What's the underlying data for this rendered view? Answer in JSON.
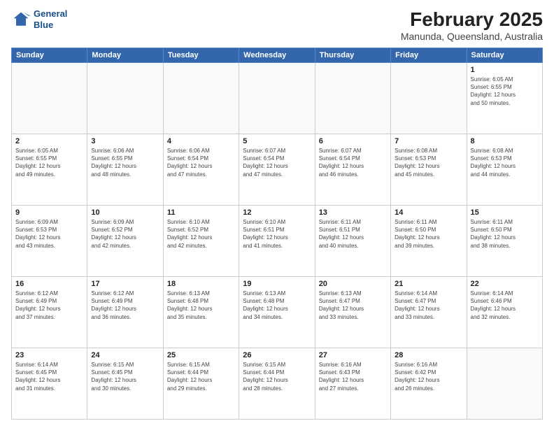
{
  "logo": {
    "line1": "General",
    "line2": "Blue"
  },
  "title": "February 2025",
  "subtitle": "Manunda, Queensland, Australia",
  "header_days": [
    "Sunday",
    "Monday",
    "Tuesday",
    "Wednesday",
    "Thursday",
    "Friday",
    "Saturday"
  ],
  "weeks": [
    [
      {
        "day": "",
        "info": ""
      },
      {
        "day": "",
        "info": ""
      },
      {
        "day": "",
        "info": ""
      },
      {
        "day": "",
        "info": ""
      },
      {
        "day": "",
        "info": ""
      },
      {
        "day": "",
        "info": ""
      },
      {
        "day": "1",
        "info": "Sunrise: 6:05 AM\nSunset: 6:55 PM\nDaylight: 12 hours\nand 50 minutes."
      }
    ],
    [
      {
        "day": "2",
        "info": "Sunrise: 6:05 AM\nSunset: 6:55 PM\nDaylight: 12 hours\nand 49 minutes."
      },
      {
        "day": "3",
        "info": "Sunrise: 6:06 AM\nSunset: 6:55 PM\nDaylight: 12 hours\nand 48 minutes."
      },
      {
        "day": "4",
        "info": "Sunrise: 6:06 AM\nSunset: 6:54 PM\nDaylight: 12 hours\nand 47 minutes."
      },
      {
        "day": "5",
        "info": "Sunrise: 6:07 AM\nSunset: 6:54 PM\nDaylight: 12 hours\nand 47 minutes."
      },
      {
        "day": "6",
        "info": "Sunrise: 6:07 AM\nSunset: 6:54 PM\nDaylight: 12 hours\nand 46 minutes."
      },
      {
        "day": "7",
        "info": "Sunrise: 6:08 AM\nSunset: 6:53 PM\nDaylight: 12 hours\nand 45 minutes."
      },
      {
        "day": "8",
        "info": "Sunrise: 6:08 AM\nSunset: 6:53 PM\nDaylight: 12 hours\nand 44 minutes."
      }
    ],
    [
      {
        "day": "9",
        "info": "Sunrise: 6:09 AM\nSunset: 6:53 PM\nDaylight: 12 hours\nand 43 minutes."
      },
      {
        "day": "10",
        "info": "Sunrise: 6:09 AM\nSunset: 6:52 PM\nDaylight: 12 hours\nand 42 minutes."
      },
      {
        "day": "11",
        "info": "Sunrise: 6:10 AM\nSunset: 6:52 PM\nDaylight: 12 hours\nand 42 minutes."
      },
      {
        "day": "12",
        "info": "Sunrise: 6:10 AM\nSunset: 6:51 PM\nDaylight: 12 hours\nand 41 minutes."
      },
      {
        "day": "13",
        "info": "Sunrise: 6:11 AM\nSunset: 6:51 PM\nDaylight: 12 hours\nand 40 minutes."
      },
      {
        "day": "14",
        "info": "Sunrise: 6:11 AM\nSunset: 6:50 PM\nDaylight: 12 hours\nand 39 minutes."
      },
      {
        "day": "15",
        "info": "Sunrise: 6:11 AM\nSunset: 6:50 PM\nDaylight: 12 hours\nand 38 minutes."
      }
    ],
    [
      {
        "day": "16",
        "info": "Sunrise: 6:12 AM\nSunset: 6:49 PM\nDaylight: 12 hours\nand 37 minutes."
      },
      {
        "day": "17",
        "info": "Sunrise: 6:12 AM\nSunset: 6:49 PM\nDaylight: 12 hours\nand 36 minutes."
      },
      {
        "day": "18",
        "info": "Sunrise: 6:13 AM\nSunset: 6:48 PM\nDaylight: 12 hours\nand 35 minutes."
      },
      {
        "day": "19",
        "info": "Sunrise: 6:13 AM\nSunset: 6:48 PM\nDaylight: 12 hours\nand 34 minutes."
      },
      {
        "day": "20",
        "info": "Sunrise: 6:13 AM\nSunset: 6:47 PM\nDaylight: 12 hours\nand 33 minutes."
      },
      {
        "day": "21",
        "info": "Sunrise: 6:14 AM\nSunset: 6:47 PM\nDaylight: 12 hours\nand 33 minutes."
      },
      {
        "day": "22",
        "info": "Sunrise: 6:14 AM\nSunset: 6:46 PM\nDaylight: 12 hours\nand 32 minutes."
      }
    ],
    [
      {
        "day": "23",
        "info": "Sunrise: 6:14 AM\nSunset: 6:45 PM\nDaylight: 12 hours\nand 31 minutes."
      },
      {
        "day": "24",
        "info": "Sunrise: 6:15 AM\nSunset: 6:45 PM\nDaylight: 12 hours\nand 30 minutes."
      },
      {
        "day": "25",
        "info": "Sunrise: 6:15 AM\nSunset: 6:44 PM\nDaylight: 12 hours\nand 29 minutes."
      },
      {
        "day": "26",
        "info": "Sunrise: 6:15 AM\nSunset: 6:44 PM\nDaylight: 12 hours\nand 28 minutes."
      },
      {
        "day": "27",
        "info": "Sunrise: 6:16 AM\nSunset: 6:43 PM\nDaylight: 12 hours\nand 27 minutes."
      },
      {
        "day": "28",
        "info": "Sunrise: 6:16 AM\nSunset: 6:42 PM\nDaylight: 12 hours\nand 26 minutes."
      },
      {
        "day": "",
        "info": ""
      }
    ]
  ],
  "colors": {
    "header_bg": "#3366aa",
    "header_text": "#ffffff",
    "accent": "#1a4f8a"
  }
}
